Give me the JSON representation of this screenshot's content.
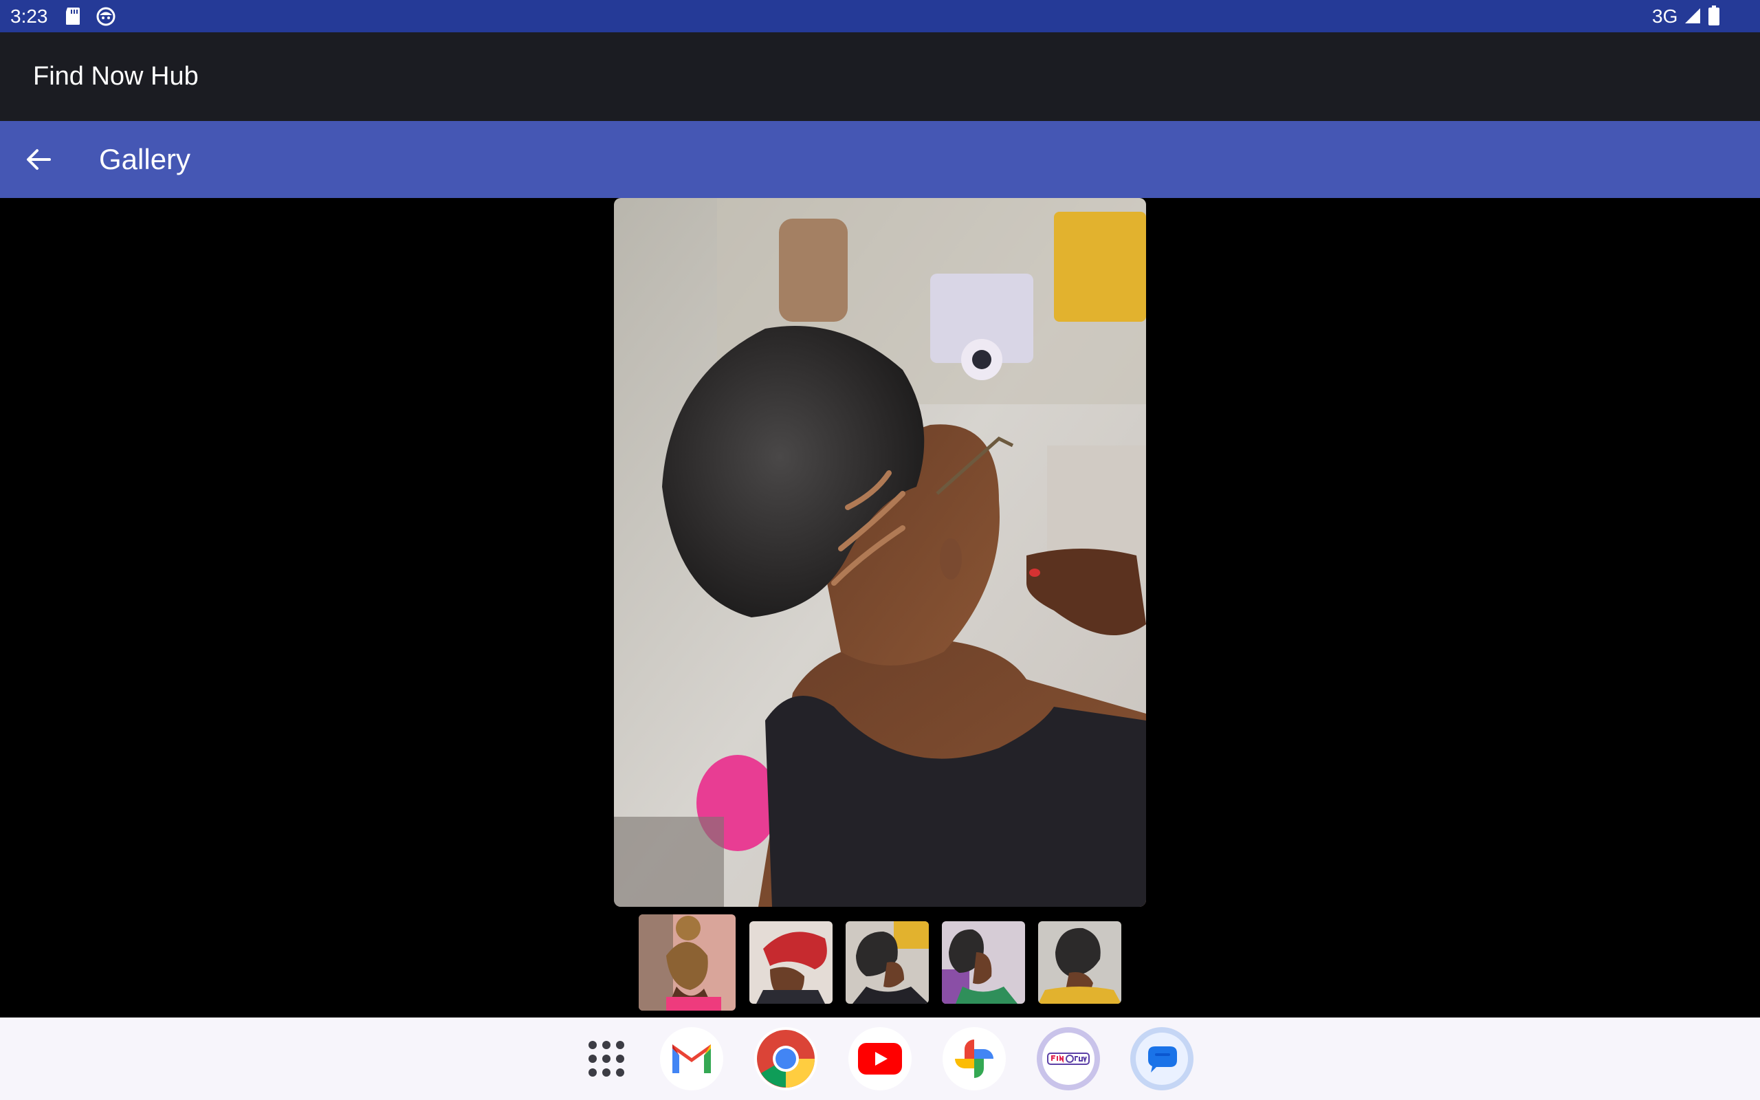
{
  "status_bar": {
    "time": "3:23",
    "network": "3G",
    "icons": [
      "sd-card-icon",
      "face-icon",
      "signal-icon",
      "battery-icon"
    ]
  },
  "app": {
    "title": "Find Now Hub"
  },
  "toolbar": {
    "title": "Gallery",
    "back_icon": "arrow-back-icon"
  },
  "gallery": {
    "selected_index": 0,
    "main_image": "photo-tapered-afro-with-shaved-design",
    "thumbnails": [
      "thumb-braided-bun",
      "thumb-red-twists",
      "thumb-tapered-cut",
      "thumb-tapered-cut-side",
      "thumb-tapered-cut-back"
    ]
  },
  "dock": {
    "apps": [
      {
        "name": "app-drawer"
      },
      {
        "name": "gmail"
      },
      {
        "name": "chrome"
      },
      {
        "name": "youtube"
      },
      {
        "name": "photos"
      },
      {
        "name": "find-now-hub"
      },
      {
        "name": "messages"
      }
    ]
  },
  "colors": {
    "status_bar": "#253a97",
    "app_bar": "#1b1c22",
    "toolbar": "#4557b4",
    "dock": "#f7f5fb"
  }
}
